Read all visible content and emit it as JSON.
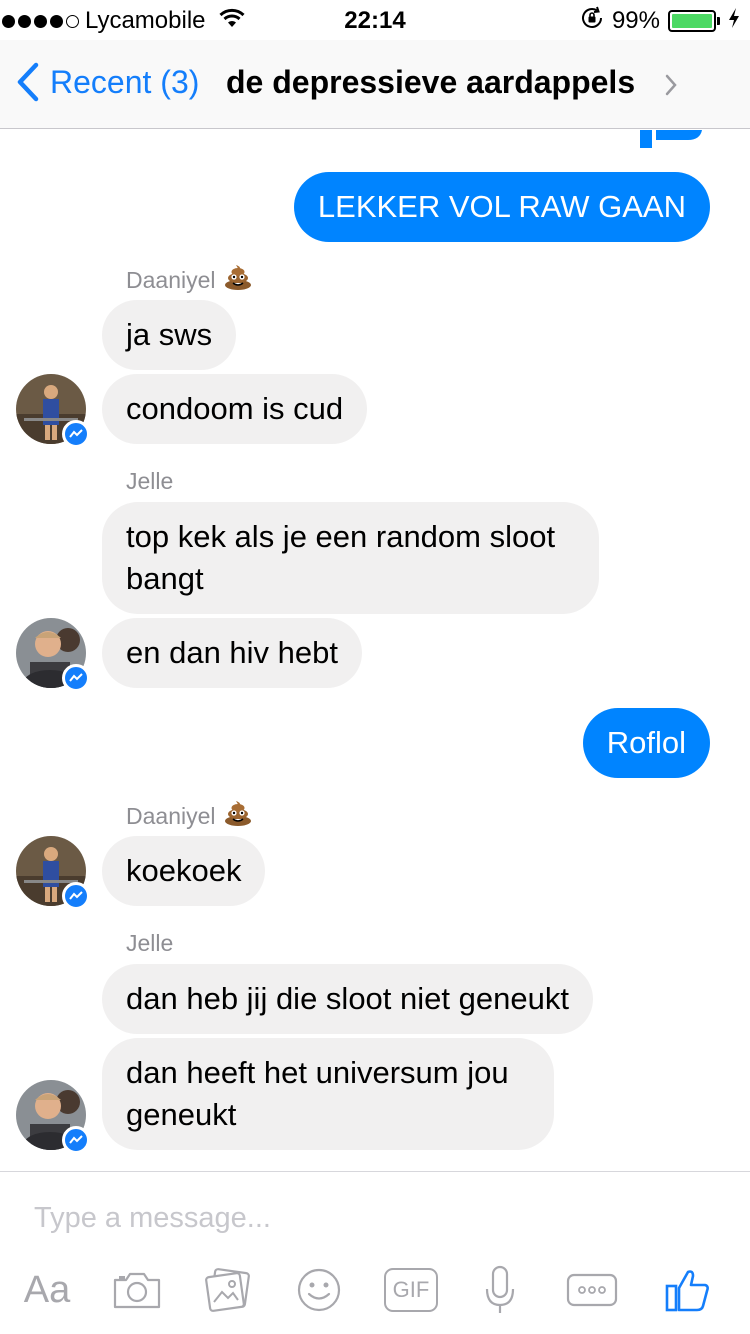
{
  "status_bar": {
    "signal_bars_filled": 4,
    "signal_bars_total": 5,
    "carrier": "Lycamobile",
    "time": "22:14",
    "battery_percent": "99%",
    "battery_level": 0.99
  },
  "nav": {
    "back_label": "Recent (3)",
    "title": "de depressieve aardappels"
  },
  "messages": {
    "m1": "LEKKER VOL RAW GAAN",
    "s1": "Daaniyel",
    "m2": "ja sws",
    "m3": "condoom is cud",
    "s2": "Jelle",
    "m4": "top kek als je een random sloot\nbangt",
    "m5": "en dan hiv hebt",
    "m6": "Roflol",
    "s3": "Daaniyel",
    "m7": "koekoek",
    "s4": "Jelle",
    "m8": "dan heb jij die sloot niet geneukt",
    "m9": "dan heeft het universum jou\ngeneukt"
  },
  "composer": {
    "placeholder": "Type a message...",
    "aa_label": "Aa",
    "gif_label": "GIF"
  },
  "colors": {
    "accent": "#147efb",
    "outgoing_bubble": "#0084ff",
    "incoming_bubble": "#f1f0f0",
    "battery_fill": "#4cd964"
  }
}
